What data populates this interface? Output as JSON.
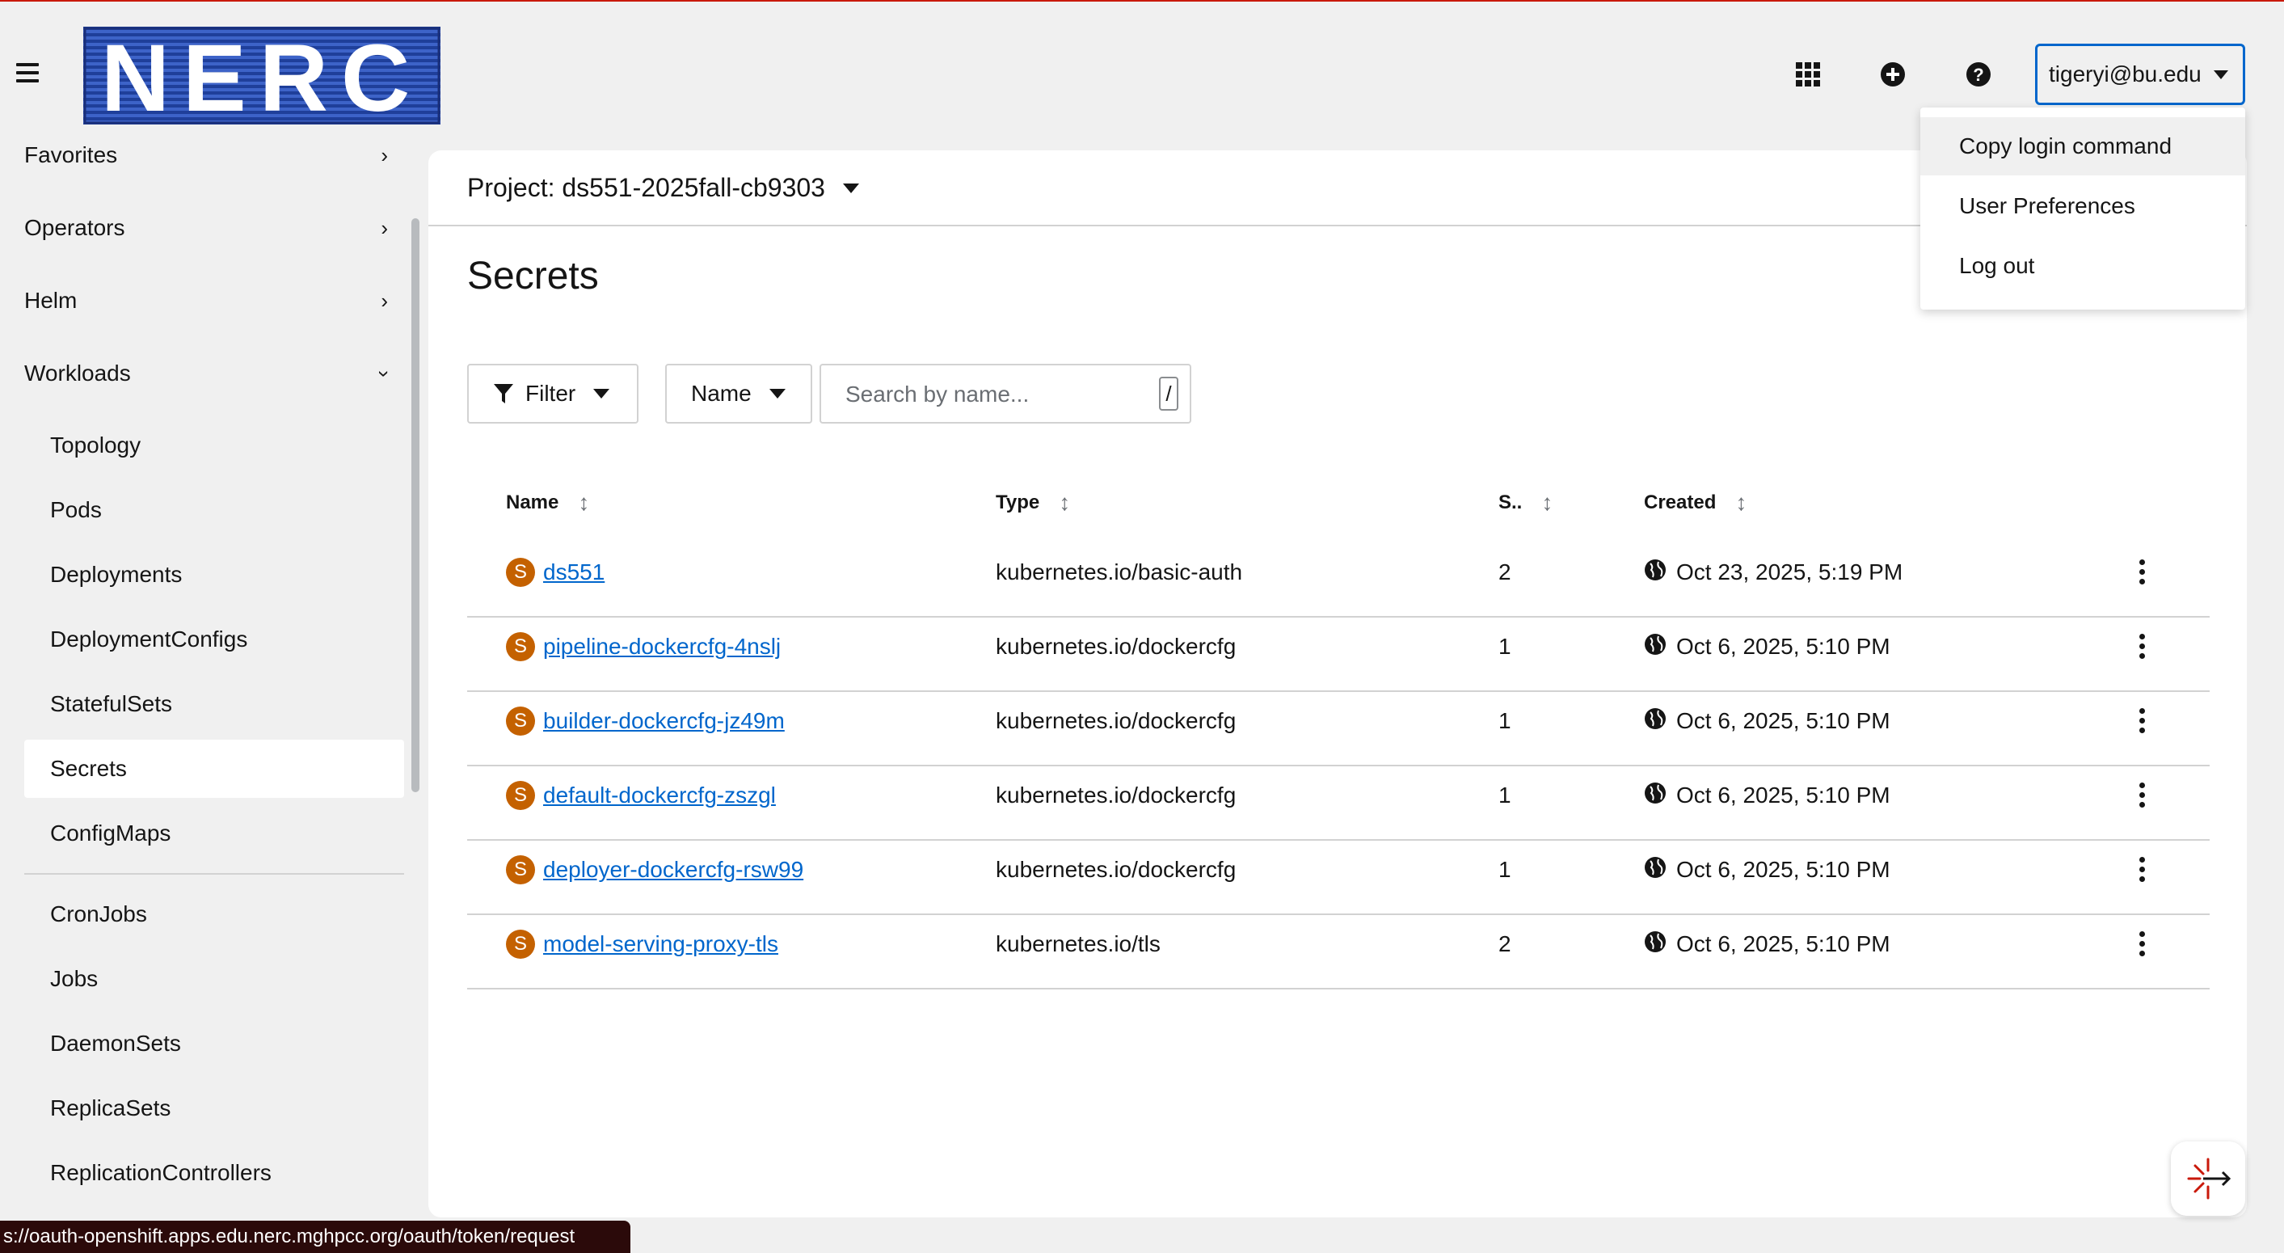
{
  "header": {
    "logo_text": "NERC",
    "user_label": "tigeryi@bu.edu"
  },
  "user_menu": {
    "items": [
      "Copy login command",
      "User Preferences",
      "Log out"
    ]
  },
  "sidebar": {
    "sections": {
      "favorites": "Favorites",
      "operators": "Operators",
      "helm": "Helm",
      "workloads": "Workloads"
    },
    "items": [
      "Topology",
      "Pods",
      "Deployments",
      "DeploymentConfigs",
      "StatefulSets",
      "Secrets",
      "ConfigMaps",
      "CronJobs",
      "Jobs",
      "DaemonSets",
      "ReplicaSets",
      "ReplicationControllers"
    ],
    "active": "Secrets"
  },
  "main": {
    "project_label": "Project: ds551-2025fall-cb9303",
    "title": "Secrets",
    "filter_label": "Filter",
    "name_select": "Name",
    "search_placeholder": "Search by name...",
    "search_shortcut": "/",
    "columns": {
      "name": "Name",
      "type": "Type",
      "size": "S..",
      "created": "Created"
    },
    "rows": [
      {
        "badge": "S",
        "name": "ds551",
        "type": "kubernetes.io/basic-auth",
        "size": "2",
        "created": "Oct 23, 2025, 5:19 PM"
      },
      {
        "badge": "S",
        "name": "pipeline-dockercfg-4nslj",
        "type": "kubernetes.io/dockercfg",
        "size": "1",
        "created": "Oct 6, 2025, 5:10 PM"
      },
      {
        "badge": "S",
        "name": "builder-dockercfg-jz49m",
        "type": "kubernetes.io/dockercfg",
        "size": "1",
        "created": "Oct 6, 2025, 5:10 PM"
      },
      {
        "badge": "S",
        "name": "default-dockercfg-zszgl",
        "type": "kubernetes.io/dockercfg",
        "size": "1",
        "created": "Oct 6, 2025, 5:10 PM"
      },
      {
        "badge": "S",
        "name": "deployer-dockercfg-rsw99",
        "type": "kubernetes.io/dockercfg",
        "size": "1",
        "created": "Oct 6, 2025, 5:10 PM"
      },
      {
        "badge": "S",
        "name": "model-serving-proxy-tls",
        "type": "kubernetes.io/tls",
        "size": "2",
        "created": "Oct 6, 2025, 5:10 PM"
      }
    ]
  },
  "status_bar": "s://oauth-openshift.apps.edu.nerc.mghpcc.org/oauth/token/request",
  "icons": {
    "menu": "hamburger-icon",
    "apps": "grid-icon",
    "add": "plus-circle-icon",
    "help": "question-circle-icon",
    "sort": "sort-icon",
    "globe": "globe-icon",
    "kebab": "kebab-icon",
    "filter": "filter-icon"
  },
  "colors": {
    "link": "#0066cc",
    "badge": "#c46100",
    "focus_border": "#0066cc",
    "top_line": "#c9190b"
  }
}
